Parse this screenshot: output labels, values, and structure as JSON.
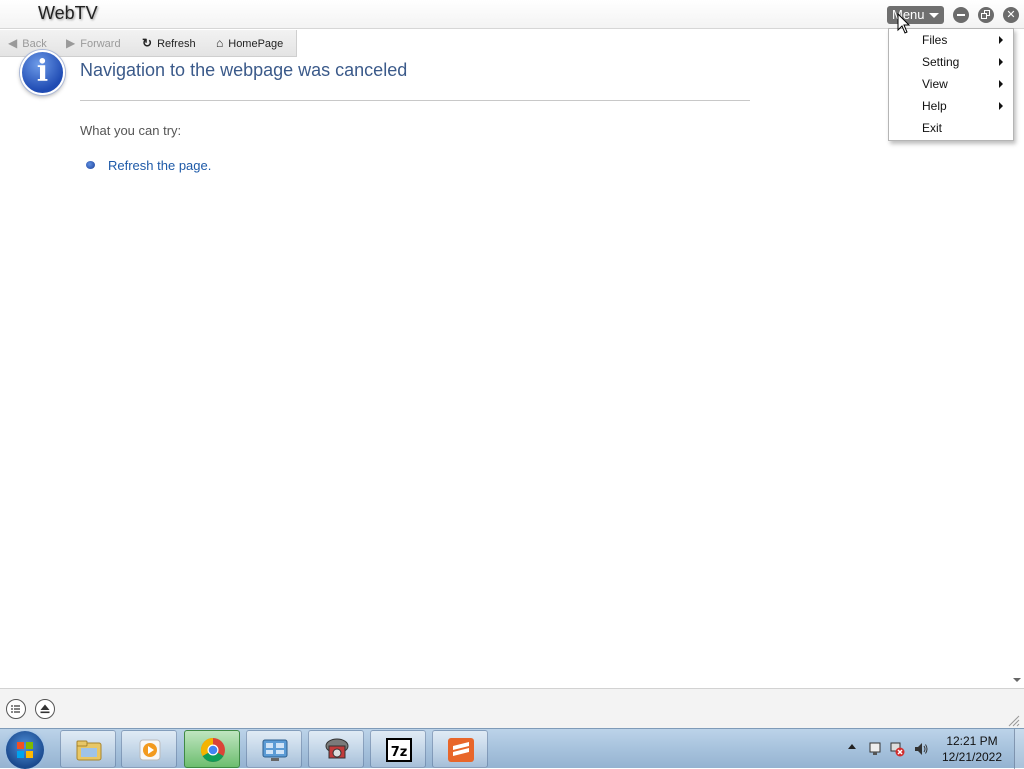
{
  "window": {
    "title": "WebTV",
    "menu_button_label": "Menu"
  },
  "navbar": {
    "back_label": "Back",
    "forward_label": "Forward",
    "refresh_label": "Refresh",
    "home_label": "HomePage"
  },
  "content": {
    "heading": "Navigation to the webpage was canceled",
    "try_label": "What you can try:",
    "refresh_link": "Refresh the page."
  },
  "dropdown": {
    "items": [
      {
        "label": "Files",
        "submenu": true
      },
      {
        "label": "Setting",
        "submenu": true
      },
      {
        "label": "View",
        "submenu": true
      },
      {
        "label": "Help",
        "submenu": true
      },
      {
        "label": "Exit",
        "submenu": false
      }
    ]
  },
  "taskbar": {
    "apps": [
      "file-explorer-icon",
      "media-player-icon",
      "chrome-icon",
      "control-panel-icon",
      "disk-utility-icon",
      "7zip-icon",
      "sublime-icon"
    ],
    "active_app": "chrome-icon",
    "clock_time": "12:21 PM",
    "clock_date": "12/21/2022"
  },
  "colors": {
    "heading": "#3b5a8a",
    "link": "#1e5aa8",
    "menu_button": "#6f6f6f",
    "taskbar": "#a9c4de"
  }
}
